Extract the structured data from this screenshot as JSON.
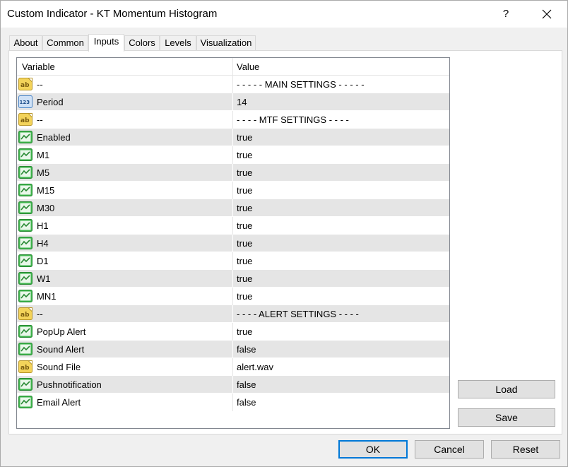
{
  "window": {
    "title": "Custom Indicator - KT Momentum Histogram",
    "help_label": "?"
  },
  "tabs": [
    {
      "label": "About"
    },
    {
      "label": "Common"
    },
    {
      "label": "Inputs",
      "active": true
    },
    {
      "label": "Colors"
    },
    {
      "label": "Levels"
    },
    {
      "label": "Visualization"
    }
  ],
  "grid": {
    "columns": [
      "Variable",
      "Value"
    ],
    "rows": [
      {
        "icon": "string-ab-icon",
        "variable": "--",
        "value": "- - - - - MAIN SETTINGS - - - - -"
      },
      {
        "icon": "integer-123-icon",
        "variable": "Period",
        "value": "14"
      },
      {
        "icon": "string-ab-icon",
        "variable": "--",
        "value": "- - - - MTF SETTINGS - - - -"
      },
      {
        "icon": "bool-icon",
        "variable": "Enabled",
        "value": "true"
      },
      {
        "icon": "bool-icon",
        "variable": "M1",
        "value": "true"
      },
      {
        "icon": "bool-icon",
        "variable": "M5",
        "value": "true"
      },
      {
        "icon": "bool-icon",
        "variable": "M15",
        "value": "true"
      },
      {
        "icon": "bool-icon",
        "variable": "M30",
        "value": "true"
      },
      {
        "icon": "bool-icon",
        "variable": "H1",
        "value": "true"
      },
      {
        "icon": "bool-icon",
        "variable": "H4",
        "value": "true"
      },
      {
        "icon": "bool-icon",
        "variable": "D1",
        "value": "true"
      },
      {
        "icon": "bool-icon",
        "variable": "W1",
        "value": "true"
      },
      {
        "icon": "bool-icon",
        "variable": "MN1",
        "value": "true"
      },
      {
        "icon": "string-ab-icon",
        "variable": "--",
        "value": "- - - - ALERT SETTINGS - - - -"
      },
      {
        "icon": "bool-icon",
        "variable": "PopUp Alert",
        "value": "true"
      },
      {
        "icon": "bool-icon",
        "variable": "Sound Alert",
        "value": "false"
      },
      {
        "icon": "string-ab-icon",
        "variable": "Sound File",
        "value": "alert.wav"
      },
      {
        "icon": "bool-icon",
        "variable": "Pushnotification",
        "value": "false"
      },
      {
        "icon": "bool-icon",
        "variable": "Email Alert",
        "value": "false"
      }
    ]
  },
  "side_buttons": {
    "load": "Load",
    "save": "Save"
  },
  "footer_buttons": {
    "ok": "OK",
    "cancel": "Cancel",
    "reset": "Reset"
  },
  "colors": {
    "accent": "#0078d7",
    "row_shade": "#e5e5e5",
    "bool_icon": "#3cb44a",
    "string_icon": "#e8c84a",
    "int_icon": "#4a86c8"
  }
}
